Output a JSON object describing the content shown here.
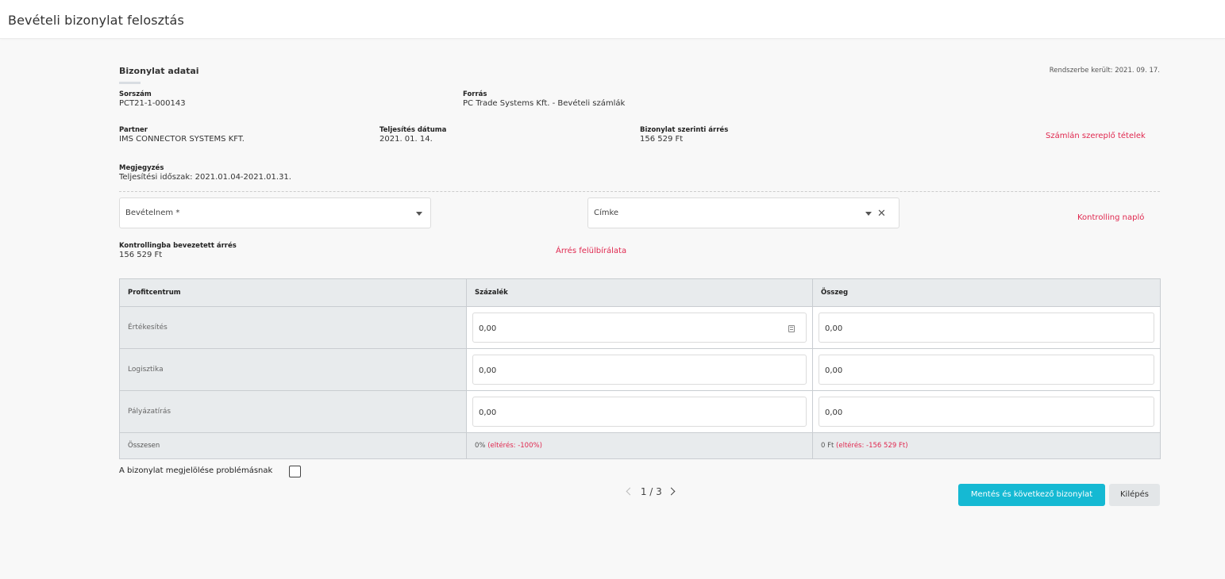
{
  "header": {
    "title": "Bevételi bizonylat felosztás"
  },
  "document": {
    "section_title": "Bizonylat adatai",
    "registered": "Rendszerbe került: 2021. 09. 17.",
    "serial_label": "Sorszám",
    "serial_value": "PCT21-1-000143",
    "source_label": "Forrás",
    "source_value": "PC Trade Systems Kft. - Bevételi számlák",
    "partner_label": "Partner",
    "partner_value": "IMS CONNECTOR SYSTEMS KFT.",
    "fulfil_label": "Teljesítés dátuma",
    "fulfil_value": "2021. 01. 14.",
    "margin_label": "Bizonylat szerinti árrés",
    "margin_value": "156 529 Ft",
    "invoice_items_link": "Számlán szereplő tételek",
    "note_label": "Megjegyzés",
    "note_value": "Teljesítési időszak: 2021.01.04-2021.01.31."
  },
  "form": {
    "revenue_placeholder": "Bevételnem *",
    "tag_placeholder": "Címke",
    "controlling_log_link": "Kontrolling napló",
    "controlling_margin_label": "Kontrollingba bevezetett árrés",
    "controlling_margin_value": "156 529 Ft",
    "margin_override_link": "Árrés felülbírálata"
  },
  "table": {
    "headers": [
      "Profitcentrum",
      "Százalék",
      "Összeg"
    ],
    "rows": [
      {
        "name": "Értékesítés",
        "percent": "0,00",
        "amount": "0,00"
      },
      {
        "name": "Logisztika",
        "percent": "0,00",
        "amount": "0,00"
      },
      {
        "name": "Pályázatírás",
        "percent": "0,00",
        "amount": "0,00"
      }
    ],
    "total": {
      "label": "Összesen",
      "percent": "0%",
      "percent_diff": "(eltérés: -100%)",
      "amount": "0 Ft",
      "amount_diff": "(eltérés: -156 529 Ft)"
    }
  },
  "footer": {
    "problem_label": "A bizonylat megjelölése problémásnak",
    "pager": "1 / 3",
    "save_next_label": "Mentés és következő bizonylat",
    "exit_label": "Kilépés"
  },
  "colors": {
    "accent": "#15b9d3",
    "link": "#e0284f"
  }
}
